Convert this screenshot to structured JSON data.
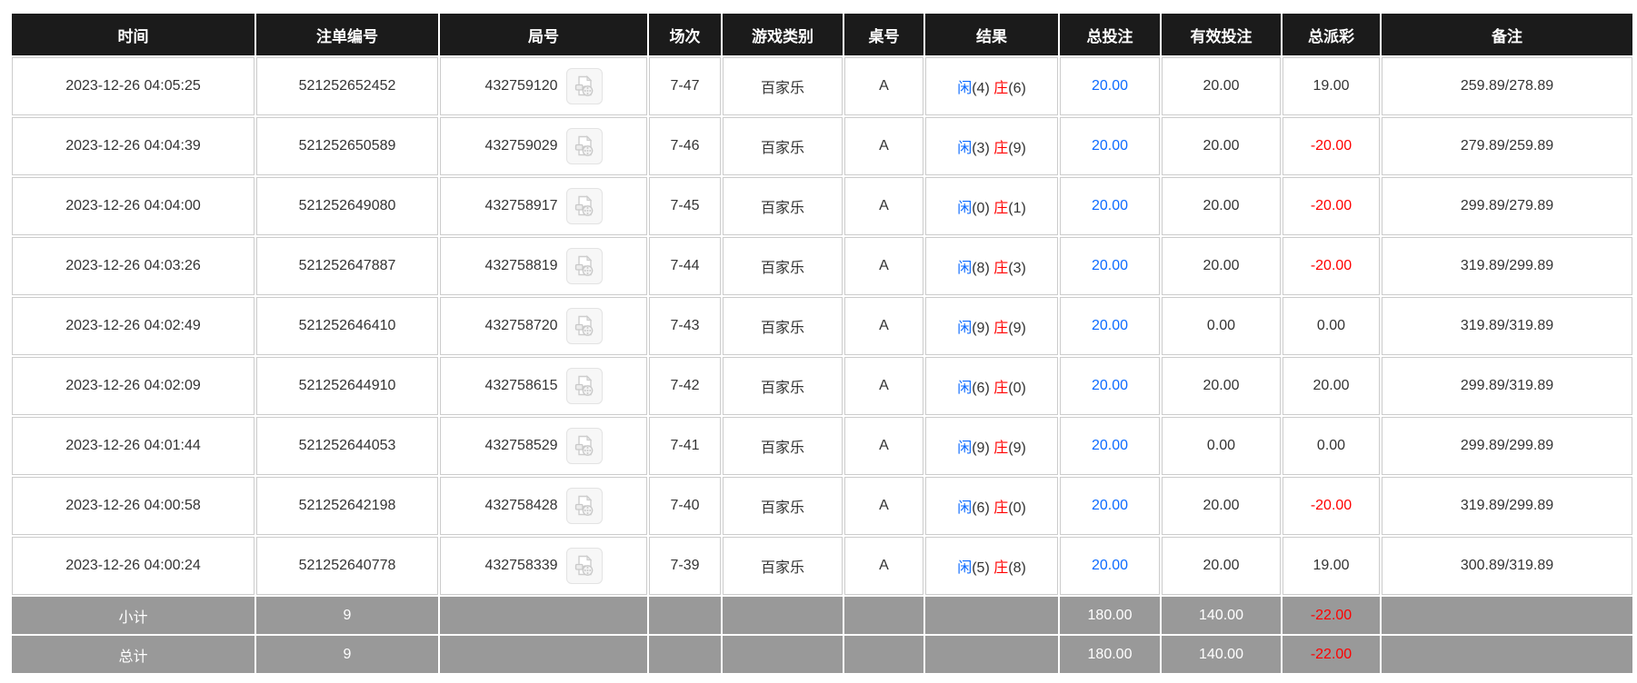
{
  "colors": {
    "header_bg": "#1b1b1b",
    "header_text": "#ffffff",
    "footer_bg": "#999999",
    "footer_text": "#ffffff",
    "cell_border": "#cccccc",
    "link_blue": "#0d6bff",
    "banker_red": "#ff0000",
    "negative_red": "#ff0000",
    "body_text": "#333333"
  },
  "table": {
    "columns": [
      {
        "key": "time",
        "label": "时间"
      },
      {
        "key": "bet_id",
        "label": "注单编号"
      },
      {
        "key": "round_id",
        "label": "局号"
      },
      {
        "key": "session",
        "label": "场次"
      },
      {
        "key": "game_type",
        "label": "游戏类别"
      },
      {
        "key": "table_no",
        "label": "桌号"
      },
      {
        "key": "result",
        "label": "结果"
      },
      {
        "key": "total_bet",
        "label": "总投注"
      },
      {
        "key": "valid_bet",
        "label": "有效投注"
      },
      {
        "key": "payout",
        "label": "总派彩"
      },
      {
        "key": "remark",
        "label": "备注"
      }
    ],
    "video_icon_name": "video-replay-icon",
    "rows": [
      {
        "time": "2023-12-26 04:05:25",
        "bet_id": "521252652452",
        "round_id": "432759120",
        "session": "7-47",
        "game_type": "百家乐",
        "table_no": "A",
        "result": {
          "player": "闲",
          "player_pts": "(4) ",
          "banker": "庄",
          "banker_pts": "(6)"
        },
        "total_bet": "20.00",
        "valid_bet": "20.00",
        "payout": "19.00",
        "remark": "259.89/278.89"
      },
      {
        "time": "2023-12-26 04:04:39",
        "bet_id": "521252650589",
        "round_id": "432759029",
        "session": "7-46",
        "game_type": "百家乐",
        "table_no": "A",
        "result": {
          "player": "闲",
          "player_pts": "(3) ",
          "banker": "庄",
          "banker_pts": "(9)"
        },
        "total_bet": "20.00",
        "valid_bet": "20.00",
        "payout": "-20.00",
        "remark": "279.89/259.89"
      },
      {
        "time": "2023-12-26 04:04:00",
        "bet_id": "521252649080",
        "round_id": "432758917",
        "session": "7-45",
        "game_type": "百家乐",
        "table_no": "A",
        "result": {
          "player": "闲",
          "player_pts": "(0) ",
          "banker": "庄",
          "banker_pts": "(1)"
        },
        "total_bet": "20.00",
        "valid_bet": "20.00",
        "payout": "-20.00",
        "remark": "299.89/279.89"
      },
      {
        "time": "2023-12-26 04:03:26",
        "bet_id": "521252647887",
        "round_id": "432758819",
        "session": "7-44",
        "game_type": "百家乐",
        "table_no": "A",
        "result": {
          "player": "闲",
          "player_pts": "(8) ",
          "banker": "庄",
          "banker_pts": "(3)"
        },
        "total_bet": "20.00",
        "valid_bet": "20.00",
        "payout": "-20.00",
        "remark": "319.89/299.89"
      },
      {
        "time": "2023-12-26 04:02:49",
        "bet_id": "521252646410",
        "round_id": "432758720",
        "session": "7-43",
        "game_type": "百家乐",
        "table_no": "A",
        "result": {
          "player": "闲",
          "player_pts": "(9) ",
          "banker": "庄",
          "banker_pts": "(9)"
        },
        "total_bet": "20.00",
        "valid_bet": "0.00",
        "payout": "0.00",
        "remark": "319.89/319.89"
      },
      {
        "time": "2023-12-26 04:02:09",
        "bet_id": "521252644910",
        "round_id": "432758615",
        "session": "7-42",
        "game_type": "百家乐",
        "table_no": "A",
        "result": {
          "player": "闲",
          "player_pts": "(6) ",
          "banker": "庄",
          "banker_pts": "(0)"
        },
        "total_bet": "20.00",
        "valid_bet": "20.00",
        "payout": "20.00",
        "remark": "299.89/319.89"
      },
      {
        "time": "2023-12-26 04:01:44",
        "bet_id": "521252644053",
        "round_id": "432758529",
        "session": "7-41",
        "game_type": "百家乐",
        "table_no": "A",
        "result": {
          "player": "闲",
          "player_pts": "(9) ",
          "banker": "庄",
          "banker_pts": "(9)"
        },
        "total_bet": "20.00",
        "valid_bet": "0.00",
        "payout": "0.00",
        "remark": "299.89/299.89"
      },
      {
        "time": "2023-12-26 04:00:58",
        "bet_id": "521252642198",
        "round_id": "432758428",
        "session": "7-40",
        "game_type": "百家乐",
        "table_no": "A",
        "result": {
          "player": "闲",
          "player_pts": "(6) ",
          "banker": "庄",
          "banker_pts": "(0)"
        },
        "total_bet": "20.00",
        "valid_bet": "20.00",
        "payout": "-20.00",
        "remark": "319.89/299.89"
      },
      {
        "time": "2023-12-26 04:00:24",
        "bet_id": "521252640778",
        "round_id": "432758339",
        "session": "7-39",
        "game_type": "百家乐",
        "table_no": "A",
        "result": {
          "player": "闲",
          "player_pts": "(5) ",
          "banker": "庄",
          "banker_pts": "(8)"
        },
        "total_bet": "20.00",
        "valid_bet": "20.00",
        "payout": "19.00",
        "remark": "300.89/319.89"
      }
    ],
    "footer_rows": [
      {
        "label": "小计",
        "count": "9",
        "round_id": "",
        "session": "",
        "game_type": "",
        "table_no": "",
        "result": "",
        "total_bet": "180.00",
        "valid_bet": "140.00",
        "payout": "-22.00",
        "remark": ""
      },
      {
        "label": "总计",
        "count": "9",
        "round_id": "",
        "session": "",
        "game_type": "",
        "table_no": "",
        "result": "",
        "total_bet": "180.00",
        "valid_bet": "140.00",
        "payout": "-22.00",
        "remark": ""
      }
    ]
  }
}
